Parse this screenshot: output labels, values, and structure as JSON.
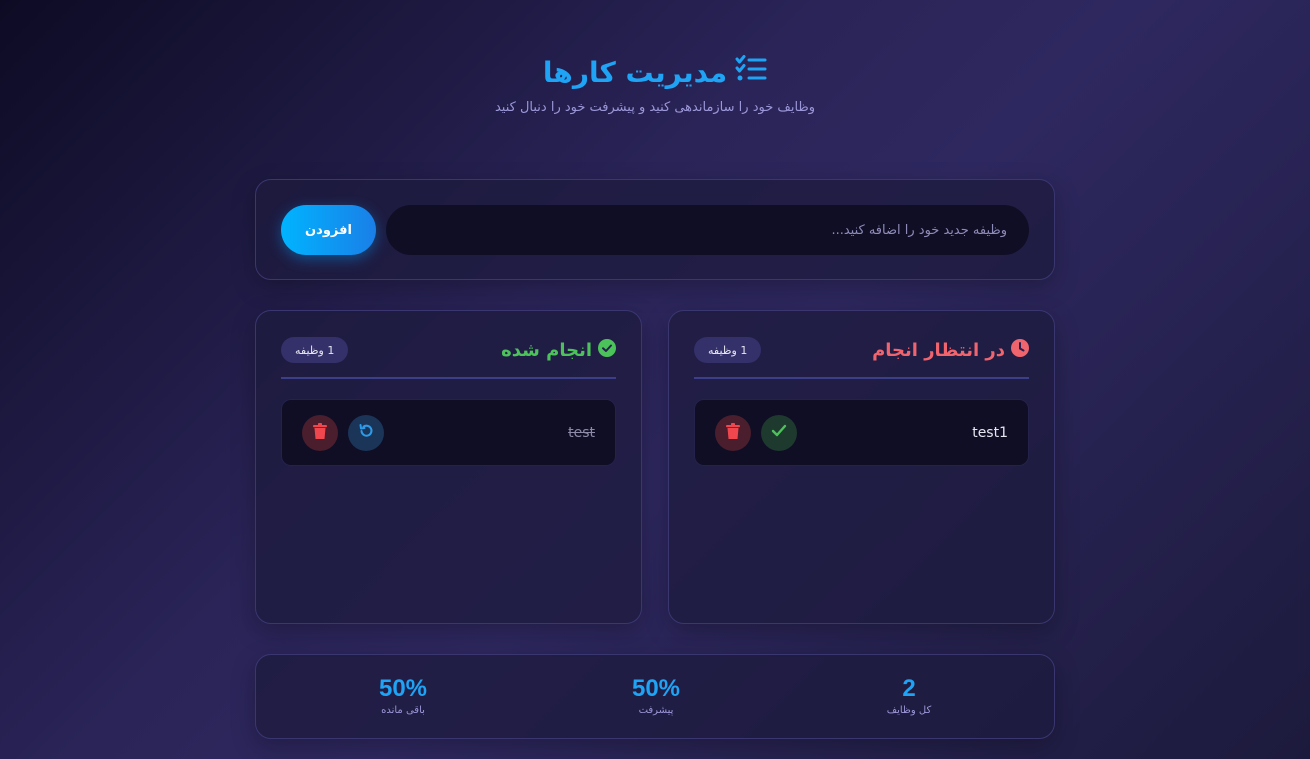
{
  "header": {
    "title": "مدیریت کارها",
    "subtitle": "وظایف خود را سازماندهی کنید و پیشرفت خود را دنبال کنید"
  },
  "add_task": {
    "placeholder": "وظیفه جدید خود را اضافه کنید...",
    "value": "",
    "button_label": "افزودن"
  },
  "pending": {
    "title": "در انتظار انجام",
    "count_badge": "1 وظیفه",
    "tasks": [
      {
        "text": "test1"
      }
    ]
  },
  "done": {
    "title": "انجام شده",
    "count_badge": "1 وظیفه",
    "tasks": [
      {
        "text": "test"
      }
    ]
  },
  "stats": {
    "total_value": "2",
    "total_label": "کل وظایف",
    "progress_value": "50%",
    "progress_label": "پیشرفت",
    "remaining_value": "50%",
    "remaining_label": "باقی مانده"
  },
  "colors": {
    "accent": "#1fa3f5",
    "pending": "#f0646e",
    "done": "#4cc25a",
    "delete": "#f0464e"
  },
  "icons": {
    "title": "tasks-checklist-icon",
    "pending": "clock-icon",
    "done": "check-circle-icon",
    "delete": "trash-icon",
    "complete": "check-icon",
    "undo": "undo-icon"
  }
}
